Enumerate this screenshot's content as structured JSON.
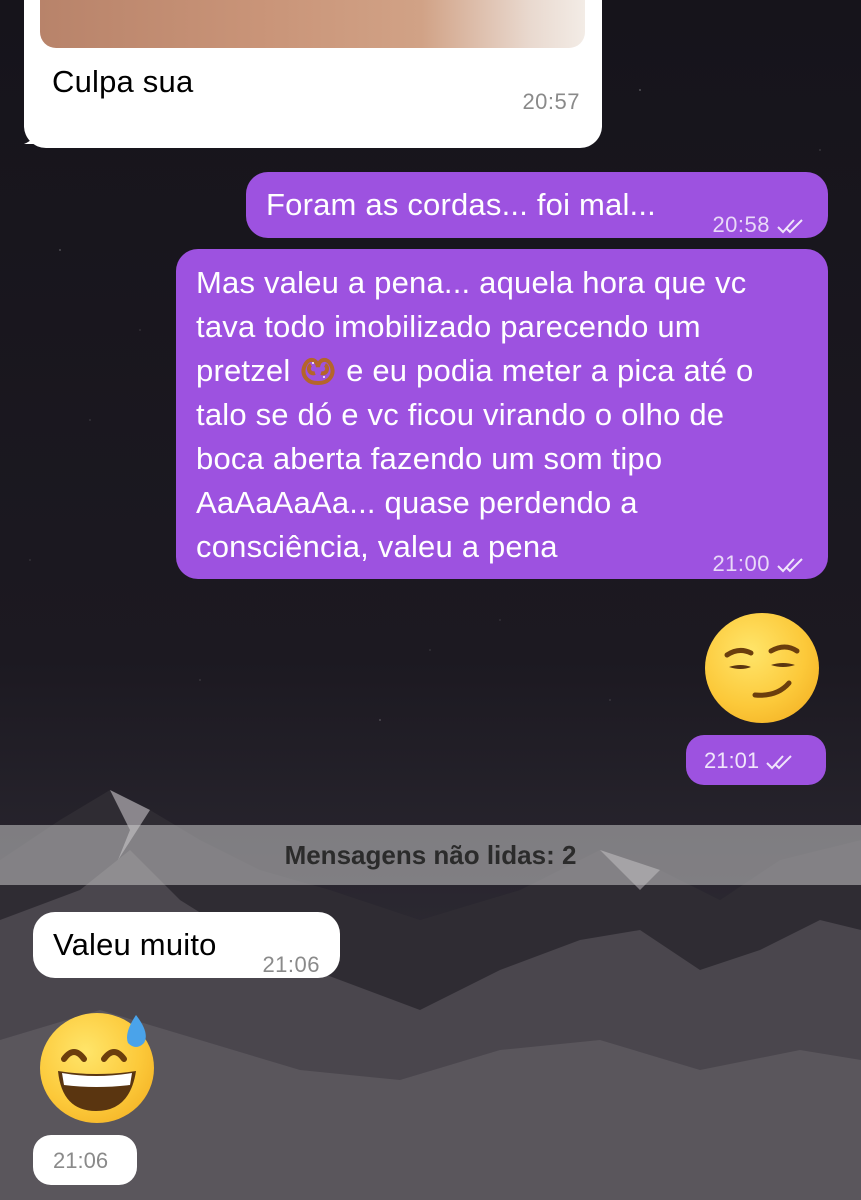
{
  "messages": {
    "photo_caption": {
      "text": "Culpa sua",
      "time": "20:57"
    },
    "cordas": {
      "text": "Foram as cordas... foi mal...",
      "time": "20:58"
    },
    "long": {
      "line1": "Mas valeu a pena... aquela hora que vc",
      "line2": "tava todo imobilizado parecendo um",
      "line3a": "pretzel ",
      "line3b": " e eu podia meter a pica até o",
      "line4": "talo se dó e vc ficou virando o olho de",
      "line5": "boca aberta fazendo um som tipo",
      "line6": "AaAaAaAa... quase perdendo a",
      "line7": "consciência, valeu  a pena",
      "time": "21:00"
    },
    "smirk": {
      "emoji": "smirking-face",
      "time": "21:01"
    },
    "valeu": {
      "text": "Valeu muito",
      "time": "21:06"
    },
    "sweat": {
      "emoji": "grinning-face-with-sweat",
      "time": "21:06"
    }
  },
  "unread_banner": "Mensagens não lidas: 2",
  "colors": {
    "outgoing_bubble": "#9d52e0",
    "incoming_bubble": "#ffffff",
    "banner": "#c8c8c8"
  }
}
